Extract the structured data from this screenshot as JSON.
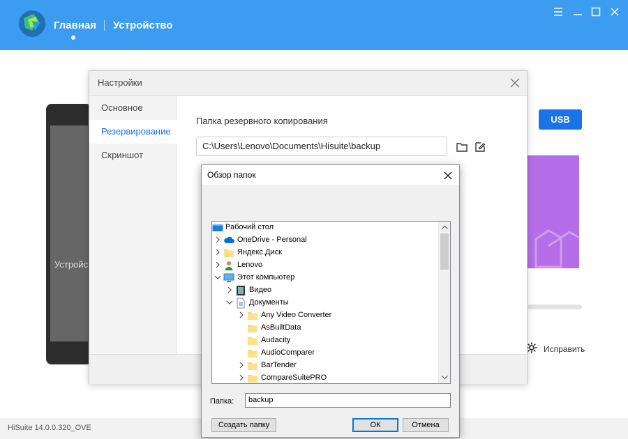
{
  "header": {
    "nav_home": "Главная",
    "nav_device": "Устройство",
    "accent": "#3b9cf0"
  },
  "window_controls": [
    "menu-icon",
    "minimize-icon",
    "maximize-icon",
    "close-icon"
  ],
  "background": {
    "phone_text": "Устройс",
    "usb_label": "USB",
    "repair_label": "Исправить",
    "version": "HiSuite 14.0.0.320_OVE"
  },
  "settings": {
    "title": "Настройки",
    "sidebar": [
      {
        "label": "Основное",
        "active": false
      },
      {
        "label": "Резервирование",
        "active": true
      },
      {
        "label": "Скриншот",
        "active": false
      }
    ],
    "backup_folder_label": "Папка резервного копирования",
    "backup_path": "C:\\Users\\Lenovo\\Documents\\Hisuite\\backup"
  },
  "browse": {
    "title": "Обзор папок",
    "tree": [
      {
        "label": "Рабочий стол",
        "icon": "desktop-icon",
        "expander": "none"
      },
      {
        "label": "OneDrive - Personal",
        "icon": "cloud-icon",
        "expander": "collapsed"
      },
      {
        "label": "Яндекс.Диск",
        "icon": "folder-icon",
        "expander": "collapsed"
      },
      {
        "label": "Lenovo",
        "icon": "user-icon",
        "expander": "collapsed"
      },
      {
        "label": "Этот компьютер",
        "icon": "computer-icon",
        "expander": "expanded"
      },
      {
        "label": "Видео",
        "icon": "video-icon",
        "expander": "collapsed"
      },
      {
        "label": "Документы",
        "icon": "documents-icon",
        "expander": "expanded"
      },
      {
        "label": "Any Video Converter",
        "icon": "folder-icon",
        "expander": "collapsed"
      },
      {
        "label": "AsBuiltData",
        "icon": "folder-icon",
        "expander": "none"
      },
      {
        "label": "Audacity",
        "icon": "folder-icon",
        "expander": "none"
      },
      {
        "label": "AudioComparer",
        "icon": "folder-icon",
        "expander": "none"
      },
      {
        "label": "BarTender",
        "icon": "folder-icon",
        "expander": "collapsed"
      },
      {
        "label": "CompareSuitePRO",
        "icon": "folder-icon",
        "expander": "collapsed"
      }
    ],
    "folder_label": "Папка:",
    "folder_value": "backup",
    "create_folder_button": "Создать папку",
    "ok_button": "ОК",
    "cancel_button": "Отмена"
  }
}
